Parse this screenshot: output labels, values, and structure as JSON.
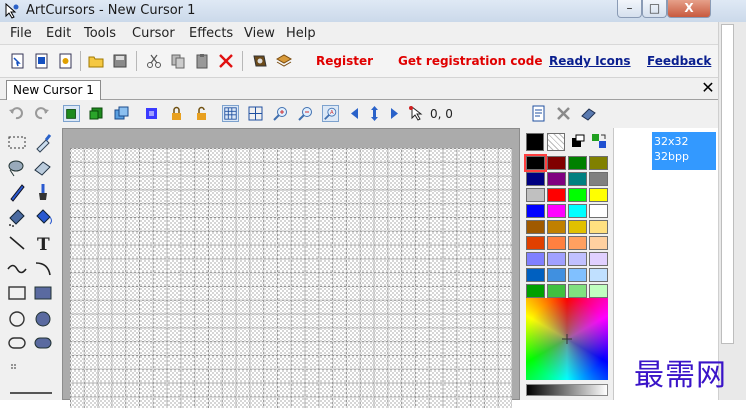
{
  "window": {
    "title": "ArtCursors - New Cursor 1",
    "controls": {
      "minimize": "–",
      "maximize": "□",
      "close": "X"
    }
  },
  "menu": [
    "File",
    "Edit",
    "Tools",
    "Cursor",
    "Effects",
    "View",
    "Help"
  ],
  "toolbar": {
    "register": "Register",
    "get_code": "Get registration code",
    "ready_icons": "Ready Icons",
    "feedback": "Feedback"
  },
  "document": {
    "tab": "New Cursor 1",
    "close": "✕"
  },
  "editor": {
    "coords": "0, 0"
  },
  "format_list": {
    "selected": [
      "32x32",
      "32bpp"
    ]
  },
  "colors": {
    "accent": "#3399ff",
    "link_red": "#e00000",
    "link_blue": "#0a1f8f",
    "palette": [
      "#000000",
      "#800000",
      "#008000",
      "#808000",
      "#000080",
      "#800080",
      "#008080",
      "#808080",
      "#c0c0c0",
      "#ff0000",
      "#00ff00",
      "#ffff00",
      "#0000ff",
      "#ff00ff",
      "#00ffff",
      "#ffffff",
      "#a05a00",
      "#c08000",
      "#e0c000",
      "#ffe080",
      "#e04000",
      "#ff8040",
      "#ffa060",
      "#ffd0a0",
      "#8080ff",
      "#a0a0ff",
      "#c0c0ff",
      "#e0d0ff",
      "#0060c0",
      "#4090e0",
      "#80c0ff",
      "#c0e0ff",
      "#00a000",
      "#40c040",
      "#80e080",
      "#c0ffc0"
    ]
  },
  "watermark": "最需网"
}
